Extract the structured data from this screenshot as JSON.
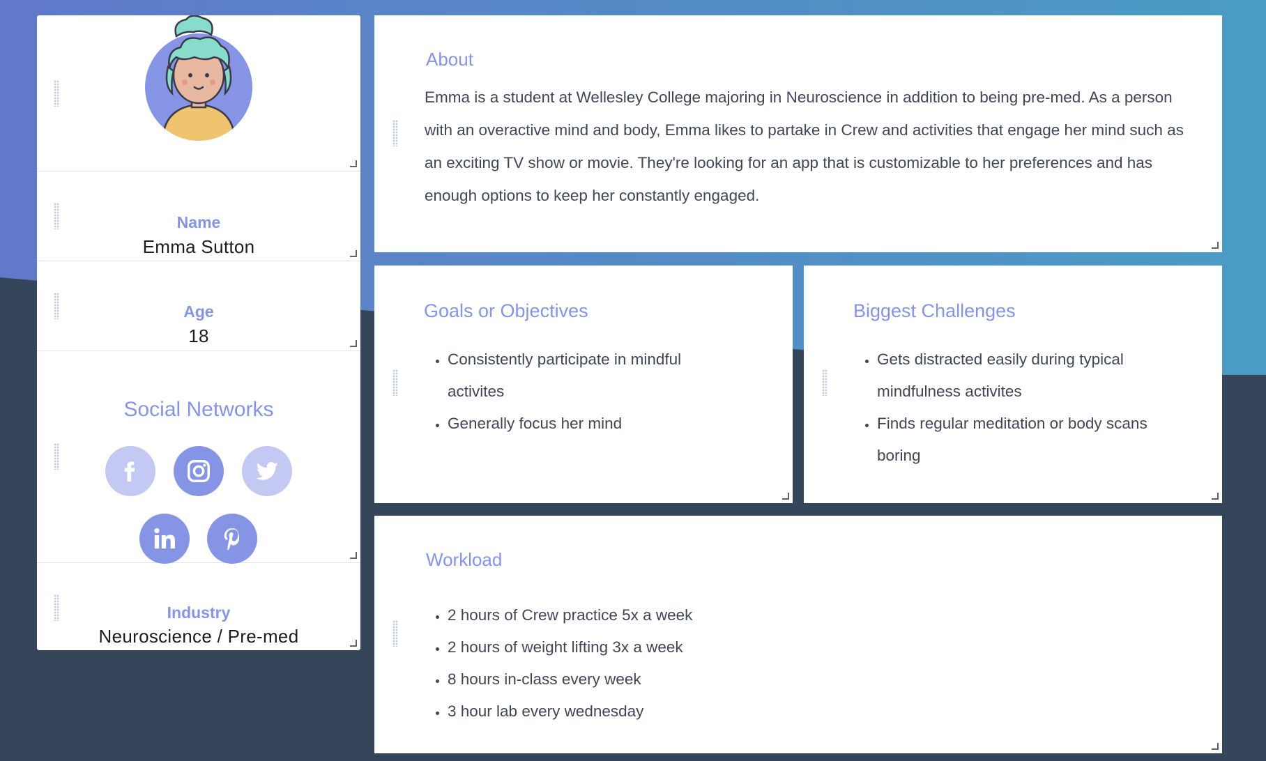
{
  "colors": {
    "accent": "#8594e4",
    "accent_light": "#c3c9f2",
    "bg_dark": "#36465a",
    "bg_gradient_start": "#6079c9",
    "bg_gradient_end": "#4a9cc4"
  },
  "profile": {
    "avatar_icon": "woman-avatar-icon",
    "name_label": "Name",
    "name_value": "Emma Sutton",
    "age_label": "Age",
    "age_value": "18",
    "social_title": "Social Networks",
    "social_networks": [
      {
        "name": "facebook",
        "icon": "facebook-icon",
        "active": false
      },
      {
        "name": "instagram",
        "icon": "instagram-icon",
        "active": true
      },
      {
        "name": "twitter",
        "icon": "twitter-icon",
        "active": false
      },
      {
        "name": "linkedin",
        "icon": "linkedin-icon",
        "active": true
      },
      {
        "name": "pinterest",
        "icon": "pinterest-icon",
        "active": true
      }
    ],
    "industry_label": "Industry",
    "industry_value": "Neuroscience / Pre-med"
  },
  "about": {
    "title": "About",
    "text": "Emma is a student at Wellesley College majoring in Neuroscience in addition to being pre-med. As a person with an overactive mind and body, Emma likes to partake in Crew and activities that engage her mind such as an exciting TV show or movie.  They're looking for an app that is customizable to her preferences and has enough options to keep her constantly engaged."
  },
  "goals": {
    "title": "Goals or Objectives",
    "items": [
      "Consistently participate in mindful activites",
      "Generally focus her mind"
    ]
  },
  "challenges": {
    "title": "Biggest Challenges",
    "items": [
      "Gets distracted easily during typical mindfulness activites",
      "Finds regular meditation or body scans boring"
    ]
  },
  "workload": {
    "title": "Workload",
    "items": [
      "2 hours of Crew practice 5x a week",
      "2 hours of weight lifting 3x a week",
      "8 hours in-class every week",
      "3 hour lab every wednesday"
    ]
  }
}
